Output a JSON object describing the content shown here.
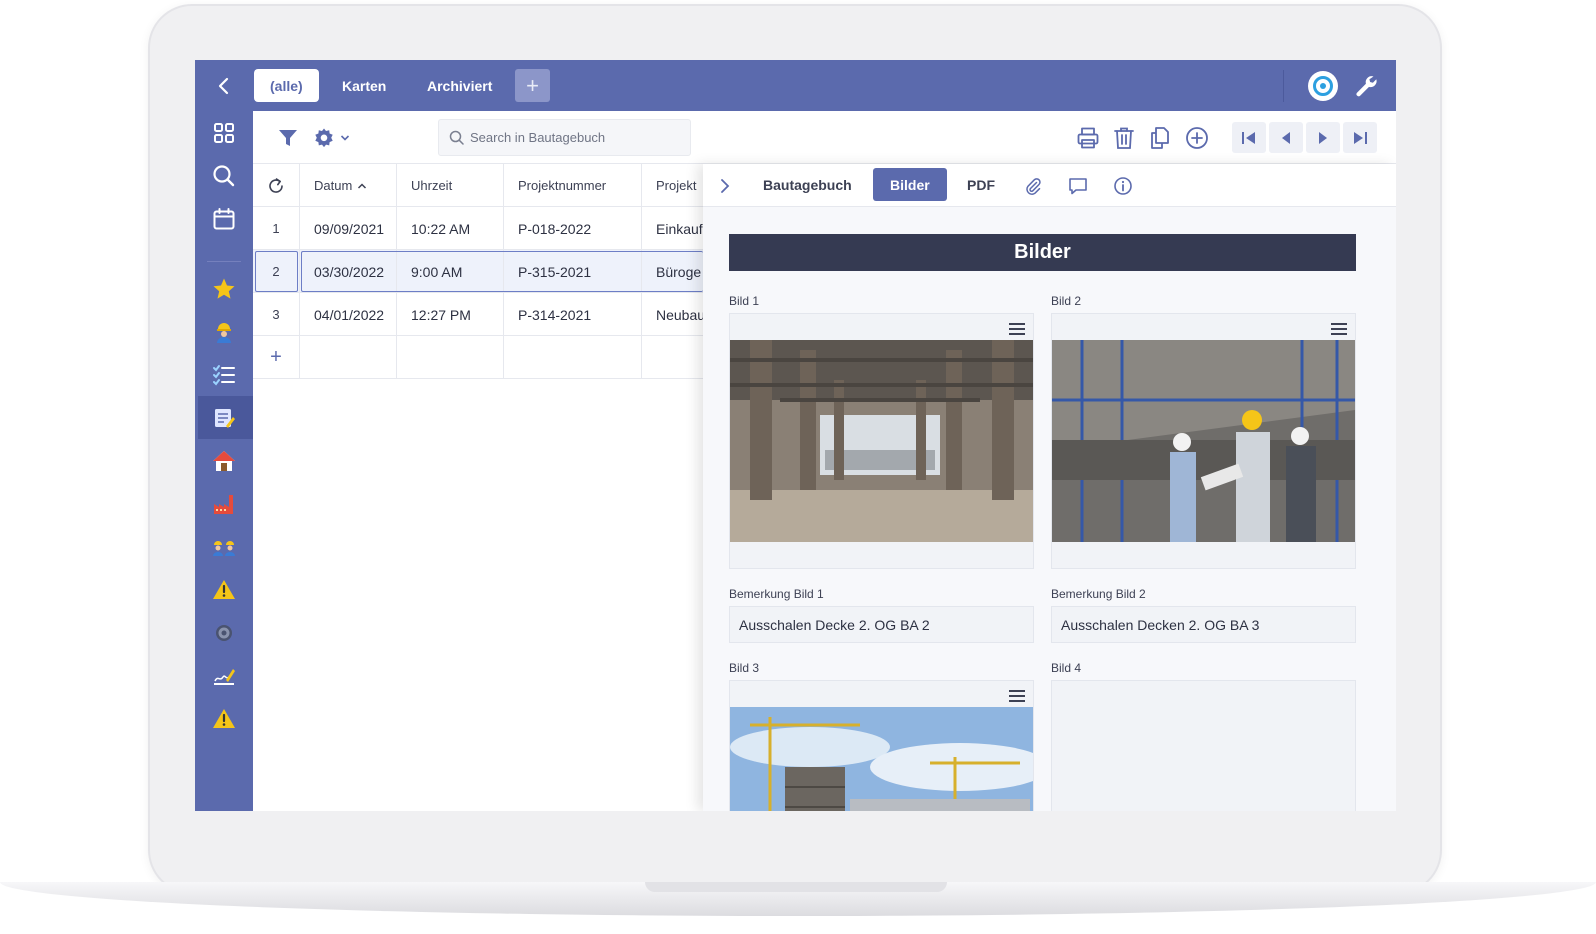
{
  "topbar": {
    "tabs": [
      {
        "label": "(alle)",
        "active": true
      },
      {
        "label": "Karten",
        "active": false
      },
      {
        "label": "Archiviert",
        "active": false
      }
    ],
    "add_tab_label": "+"
  },
  "sidebar": {
    "icons": [
      "dashboard-icon",
      "search-icon",
      "calendar-icon",
      "star-icon",
      "worker-icon",
      "checklist-icon",
      "diary-icon",
      "house-icon",
      "factory-icon",
      "team-icon",
      "warning-icon",
      "gear-icon",
      "signature-icon",
      "warning-icon"
    ],
    "active_item": "diary"
  },
  "toolbar": {
    "search_placeholder": "Search in Bautagebuch"
  },
  "grid": {
    "columns": [
      "Datum",
      "Uhrzeit",
      "Projektnummer",
      "Projekt"
    ],
    "sort_column": "Datum",
    "sort_direction": "asc",
    "rows": [
      {
        "num": "1",
        "datum": "09/09/2021",
        "uhrzeit": "10:22 AM",
        "projektnummer": "P-018-2022",
        "projekt": "Einkauf"
      },
      {
        "num": "2",
        "datum": "03/30/2022",
        "uhrzeit": "9:00 AM",
        "projektnummer": "P-315-2021",
        "projekt": "Büroge"
      },
      {
        "num": "3",
        "datum": "04/01/2022",
        "uhrzeit": "12:27 PM",
        "projektnummer": "P-314-2021",
        "projekt": "Neubau"
      }
    ],
    "selected_row": 2,
    "add_row_label": "+"
  },
  "detail": {
    "tabs": [
      {
        "label": "Bautagebuch",
        "active": false
      },
      {
        "label": "Bilder",
        "active": true
      },
      {
        "label": "PDF",
        "active": false
      }
    ],
    "section_title": "Bilder",
    "images": [
      {
        "label": "Bild 1",
        "remark_label": "Bemerkung Bild 1",
        "remark": "Ausschalen Decke 2. OG BA 2"
      },
      {
        "label": "Bild 2",
        "remark_label": "Bemerkung Bild 2",
        "remark": "Ausschalen Decken 2. OG BA 3"
      },
      {
        "label": "Bild 3"
      },
      {
        "label": "Bild 4"
      }
    ]
  },
  "colors": {
    "brand": "#5b6aad",
    "section_header": "#353a52",
    "target_accent": "#2da0e0"
  }
}
